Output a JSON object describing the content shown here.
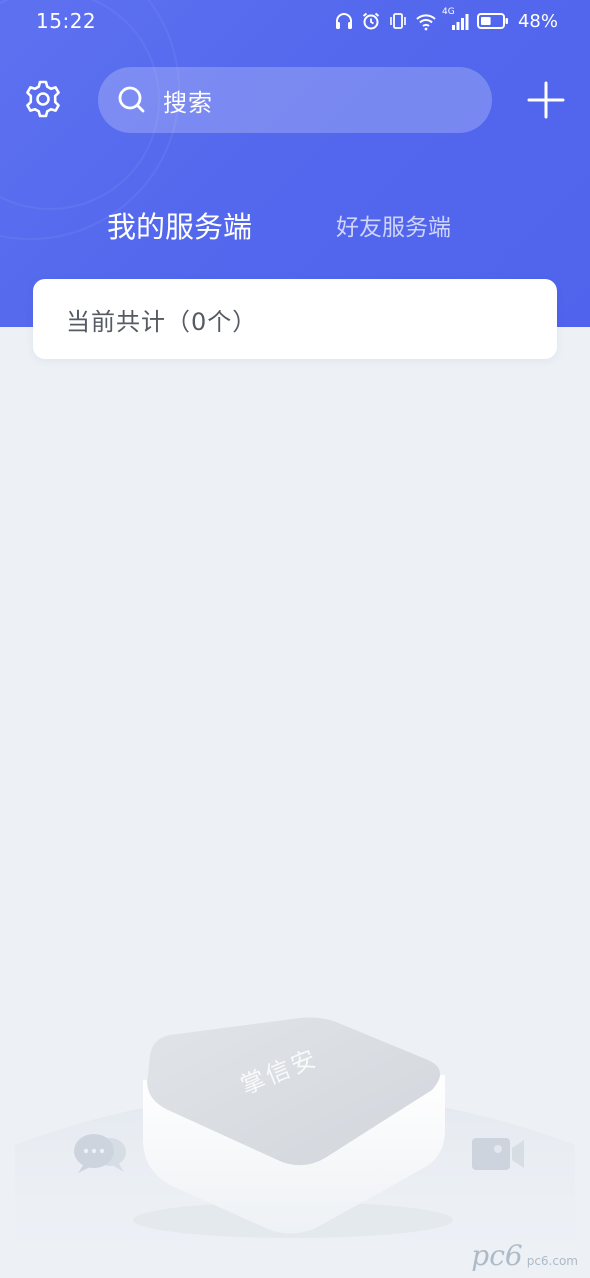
{
  "status_bar": {
    "time": "15:22",
    "network_label": "4G",
    "battery_percent": "48%",
    "battery_level": 0.48,
    "icons": [
      "headphones-icon",
      "alarm-icon",
      "vibrate-icon",
      "wifi-icon",
      "signal-icon",
      "battery-icon"
    ]
  },
  "toolbar": {
    "settings_icon": "gear-icon",
    "search_placeholder": "搜索",
    "add_icon": "plus-icon"
  },
  "tabs": [
    {
      "label": "我的服务端",
      "active": true
    },
    {
      "label": "好友服务端",
      "active": false
    }
  ],
  "count_card": {
    "text": "当前共计（0个）"
  },
  "illustration": {
    "device_brand": "掌信安",
    "icons": [
      "chat-bubbles-icon",
      "video-camera-icon"
    ]
  },
  "watermark": {
    "main": "pc6",
    "domain": "pc6.com"
  },
  "colors": {
    "header_primary": "#5468ee",
    "background": "#edf1f6",
    "card": "#ffffff",
    "text_primary": "#ffffff",
    "text_secondary": "#555a63"
  }
}
